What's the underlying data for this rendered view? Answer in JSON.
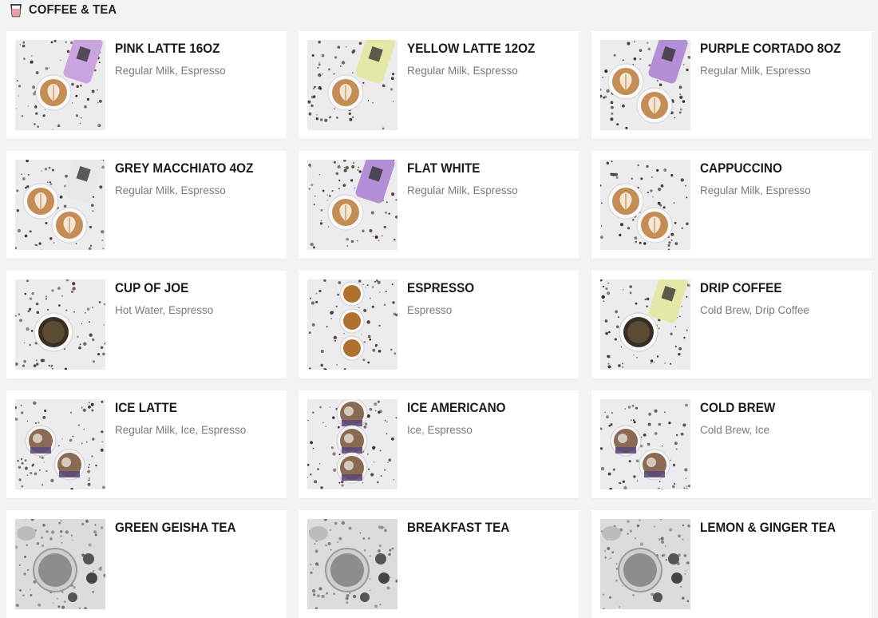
{
  "section": {
    "title": "COFFEE & TEA",
    "icon": "cup-icon"
  },
  "items": [
    {
      "name": "PINK LATTE 16OZ",
      "description": "Regular Milk, Espresso",
      "image": "coffee-photo",
      "cup_color": "#c9a4de",
      "cups": 1,
      "tone": "color"
    },
    {
      "name": "YELLOW LATTE 12OZ",
      "description": "Regular Milk, Espresso",
      "image": "coffee-photo",
      "cup_color": "#e3e8a8",
      "cups": 1,
      "tone": "color"
    },
    {
      "name": "PURPLE CORTADO 8OZ",
      "description": "Regular Milk, Espresso",
      "image": "coffee-photo",
      "cup_color": "#b48ed6",
      "cups": 2,
      "tone": "color"
    },
    {
      "name": "GREY MACCHIATO 4OZ",
      "description": "Regular Milk, Espresso",
      "image": "coffee-photo",
      "cup_color": "#e8e8ec",
      "cups": 2,
      "tone": "color"
    },
    {
      "name": "FLAT WHITE",
      "description": "Regular Milk, Espresso",
      "image": "coffee-photo",
      "cup_color": "#b48ed6",
      "cups": 1,
      "tone": "color"
    },
    {
      "name": "CAPPUCCINO",
      "description": "Regular Milk, Espresso",
      "image": "coffee-photo",
      "cup_color": "",
      "cups": 2,
      "tone": "color"
    },
    {
      "name": "CUP OF JOE",
      "description": "Hot Water, Espresso",
      "image": "coffee-photo",
      "cup_color": "",
      "cups": 1,
      "tone": "dark"
    },
    {
      "name": "ESPRESSO",
      "description": "Espresso",
      "image": "coffee-photo",
      "cup_color": "",
      "cups": 3,
      "tone": "espresso"
    },
    {
      "name": "DRIP COFFEE",
      "description": "Cold Brew, Drip Coffee",
      "image": "coffee-photo",
      "cup_color": "#e3e8a8",
      "cups": 1,
      "tone": "dark"
    },
    {
      "name": "ICE LATTE",
      "description": "Regular Milk, Ice, Espresso",
      "image": "iced-coffee-photo",
      "cup_color": "#5a4a78",
      "cups": 2,
      "tone": "iced"
    },
    {
      "name": "ICE AMERICANO",
      "description": "Ice, Espresso",
      "image": "iced-coffee-photo",
      "cup_color": "#5a4a78",
      "cups": 3,
      "tone": "iced"
    },
    {
      "name": "COLD BREW",
      "description": "Cold Brew, Ice",
      "image": "iced-coffee-photo",
      "cup_color": "#5a4a78",
      "cups": 2,
      "tone": "iced"
    },
    {
      "name": "GREEN GEISHA TEA",
      "description": "",
      "image": "tea-photo",
      "cup_color": "",
      "cups": 1,
      "tone": "tea"
    },
    {
      "name": "BREAKFAST TEA",
      "description": "",
      "image": "tea-photo",
      "cup_color": "",
      "cups": 1,
      "tone": "tea"
    },
    {
      "name": "LEMON & GINGER TEA",
      "description": "",
      "image": "tea-photo",
      "cup_color": "",
      "cups": 1,
      "tone": "tea"
    }
  ]
}
